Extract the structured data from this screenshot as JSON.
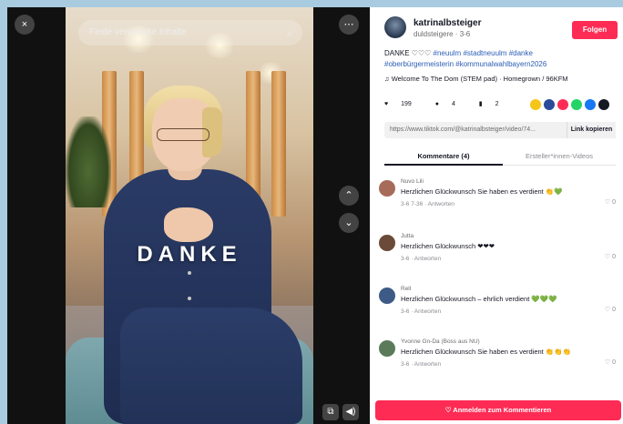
{
  "player": {
    "close_icon": "×",
    "more_icon": "⋯",
    "search_placeholder": "Finde verwandte Inhalte",
    "search_icon": "⌕",
    "overlay_text": "DANKE",
    "nav_up_icon": "⌃",
    "nav_down_icon": "⌄",
    "pip_icon": "⧉",
    "volume_icon": "◀)"
  },
  "author": {
    "username": "katrinalbsteiger",
    "subline": "duldsteigere · 3-6",
    "follow_label": "Folgen"
  },
  "caption": {
    "text": "DANKE ♡♡♡ ",
    "hashtags_line1": "#neuulm #stadtneuulm #danke",
    "hashtags_line2": "#oberbürgermeisterin #kommunalwahlbayern2026"
  },
  "music": {
    "icon": "♫",
    "text": "Welcome To The Dom (STEM pad) · Homegrown / 96KFM"
  },
  "stats": {
    "likes_icon": "♥",
    "likes": "199",
    "comments_icon": "●",
    "comments": "4",
    "saves_icon": "▮",
    "saves": "2"
  },
  "share_colors": [
    "#f5c518",
    "#2b4a9a",
    "#fe2c55",
    "#25d366",
    "#1877f2",
    "#161823"
  ],
  "link": {
    "url": "https://www.tiktok.com/@katrinalbsteiger/video/74...",
    "copy_label": "Link kopieren"
  },
  "tabs": {
    "comments_label": "Kommentare (4)",
    "creator_label": "Ersteller*innen-Videos"
  },
  "comments": [
    {
      "user": "Nuvo Lili",
      "text": "Herzlichen Glückwunsch Sie haben es verdient 👏💚",
      "meta": "3-6 7-36 · Antworten",
      "like_count": "0",
      "avatar_color": "#a76b5a"
    },
    {
      "user": "Jutta",
      "text": "Herzlichen Glückwunsch ❤❤❤",
      "meta": "3-6 · Antworten",
      "like_count": "0",
      "avatar_color": "#6b4a3a"
    },
    {
      "user": "Rell",
      "text": "Herzlichen Glückwunsch – ehrlich verdient 💚💚💚",
      "meta": "3-6 · Antworten",
      "like_count": "0",
      "avatar_color": "#3d5b86"
    },
    {
      "user": "Yvonne Gn-Da (Boss aus NU)",
      "text": "Herzlichen Glückwunsch Sie haben es verdient 👏👏👏",
      "meta": "3-6 · Antworten",
      "like_count": "0",
      "avatar_color": "#5a7a5a"
    }
  ],
  "like_icon": "♡",
  "comment_bar": {
    "label": "♡ Anmelden zum Kommentieren"
  }
}
